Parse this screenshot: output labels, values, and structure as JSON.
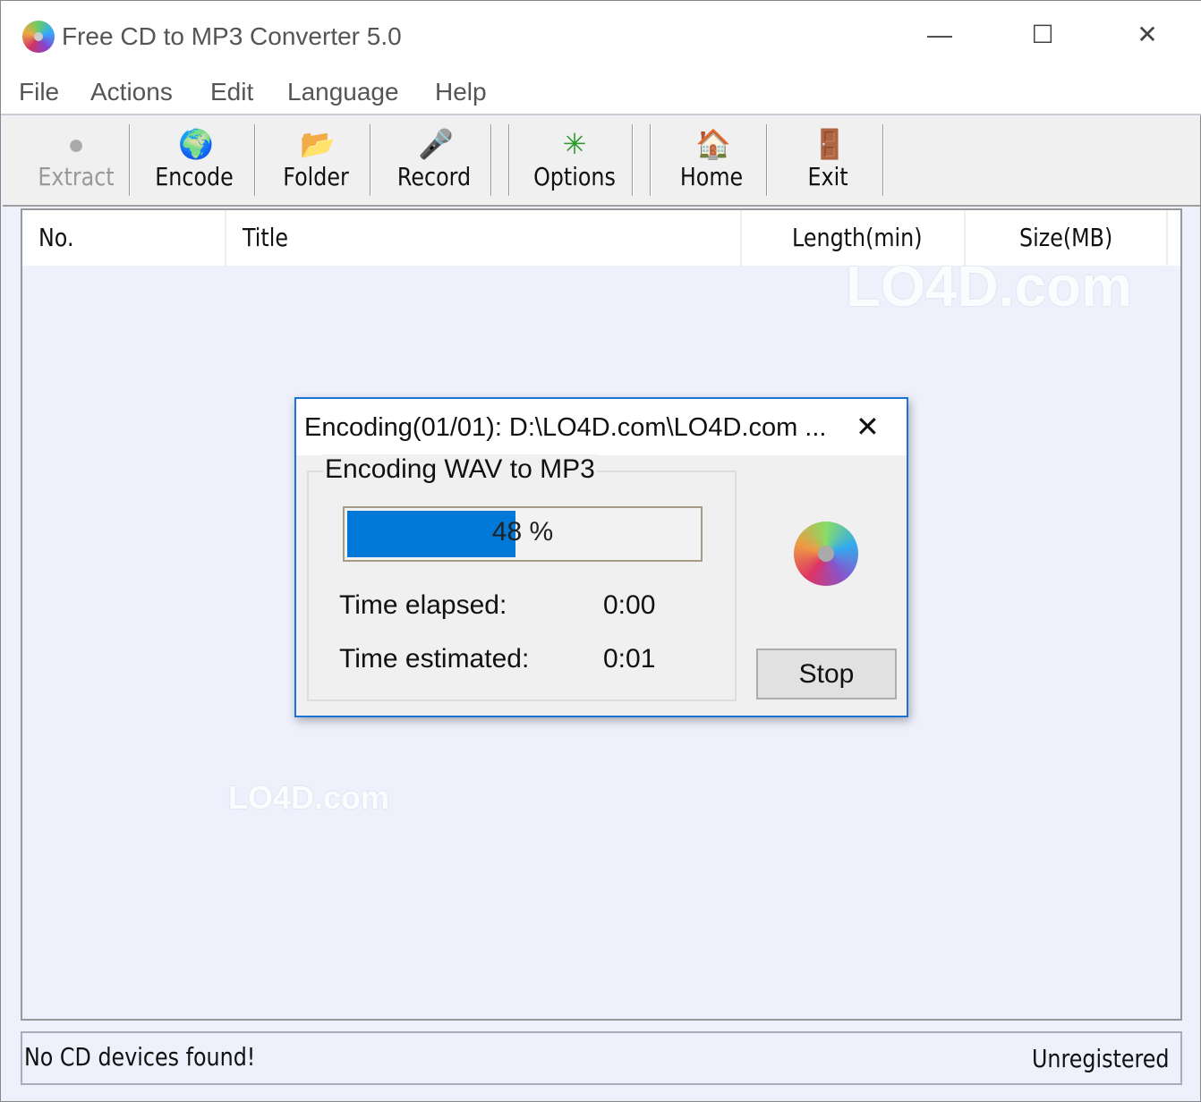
{
  "window": {
    "title": "Free CD to MP3 Converter 5.0",
    "minimize": "—",
    "maximize": "☐",
    "close": "✕"
  },
  "menu": [
    "File",
    "Actions",
    "Edit",
    "Language",
    "Help"
  ],
  "toolbar": [
    {
      "label": "Extract",
      "icon": "extract-cd-icon",
      "disabled": true
    },
    {
      "label": "Encode",
      "icon": "globe-download-icon"
    },
    {
      "label": "Folder",
      "icon": "folder-icon"
    },
    {
      "label": "Record",
      "icon": "microphone-icon"
    },
    {
      "label": "Options",
      "icon": "options-icon"
    },
    {
      "label": "Home",
      "icon": "home-icon"
    },
    {
      "label": "Exit",
      "icon": "exit-door-icon"
    }
  ],
  "columns": [
    "No.",
    "Title",
    "Length(min)",
    "Size(MB)"
  ],
  "watermark": "LO4D.com",
  "status": {
    "left": "No CD devices found!",
    "right": "Unregistered"
  },
  "dialog": {
    "title": "Encoding(01/01): D:\\LO4D.com\\LO4D.com ...",
    "close": "✕",
    "group_label": "Encoding WAV to MP3",
    "progress_percent": 48,
    "progress_text": "48 %",
    "elapsed_label": "Time elapsed:",
    "elapsed_value": "0:00",
    "estimated_label": "Time estimated:",
    "estimated_value": "0:01",
    "stop_label": "Stop"
  },
  "colors": {
    "progress": "#0078d7",
    "list_bg": "#eef0fc",
    "dialog_border": "#1a73d6"
  }
}
